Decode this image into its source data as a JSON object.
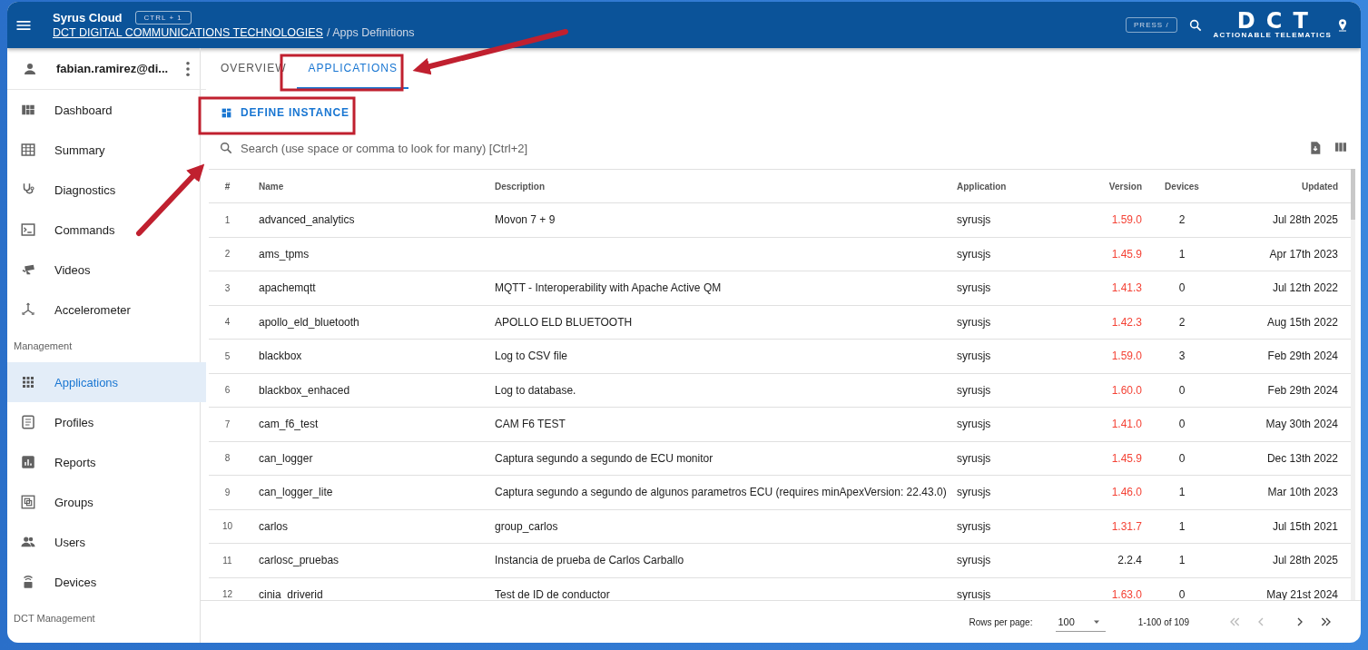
{
  "header": {
    "title": "Syrus Cloud",
    "shortcut": "CTRL + 1",
    "breadcrumb_link": "DCT DIGITAL COMMUNICATIONS TECHNOLOGIES",
    "breadcrumb_current": "/ Apps Definitions",
    "search_shortcut": "PRESS /",
    "logo_text": "DCT",
    "logo_tagline": "ACTIONABLE TELEMATICS"
  },
  "sidebar": {
    "user": "fabian.ramirez@di...",
    "nav": [
      {
        "kind": "link",
        "label": "Dashboard",
        "selected": false
      },
      {
        "kind": "link",
        "label": "Summary",
        "selected": false
      },
      {
        "kind": "link",
        "label": "Diagnostics",
        "selected": false
      },
      {
        "kind": "link",
        "label": "Commands",
        "selected": false
      },
      {
        "kind": "link",
        "label": "Videos",
        "selected": false
      },
      {
        "kind": "link",
        "label": "Accelerometer",
        "selected": false
      },
      {
        "kind": "heading",
        "label": "Management"
      },
      {
        "kind": "link",
        "label": "Applications",
        "selected": true
      },
      {
        "kind": "link",
        "label": "Profiles",
        "selected": false
      },
      {
        "kind": "link",
        "label": "Reports",
        "selected": false
      },
      {
        "kind": "link",
        "label": "Groups",
        "selected": false
      },
      {
        "kind": "link",
        "label": "Users",
        "selected": false
      },
      {
        "kind": "link",
        "label": "Devices",
        "selected": false
      },
      {
        "kind": "heading",
        "label": "DCT Management"
      }
    ]
  },
  "tabs": [
    {
      "label": "OVERVIEW",
      "selected": false
    },
    {
      "label": "APPLICATIONS",
      "selected": true
    }
  ],
  "define_button": "DEFINE INSTANCE",
  "search": {
    "placeholder": "Search (use space or comma to look for many) [Ctrl+2]"
  },
  "table": {
    "columns": [
      "#",
      "Name",
      "Description",
      "Application",
      "Version",
      "Devices",
      "Updated"
    ],
    "rows": [
      {
        "index": "1",
        "name": "advanced_analytics",
        "description": "Movon 7 + 9",
        "application": "syrusjs",
        "version": {
          "text": "1.59.0",
          "color": "#f44336"
        },
        "devices": "2",
        "updated": "Jul 28th 2025"
      },
      {
        "index": "2",
        "name": "ams_tpms",
        "description": "",
        "application": "syrusjs",
        "version": {
          "text": "1.45.9",
          "color": "#f44336"
        },
        "devices": "1",
        "updated": "Apr 17th 2023"
      },
      {
        "index": "3",
        "name": "apachemqtt",
        "description": "MQTT - Interoperability with Apache Active QM",
        "application": "syrusjs",
        "version": {
          "text": "1.41.3",
          "color": "#f44336"
        },
        "devices": "0",
        "updated": "Jul 12th 2022"
      },
      {
        "index": "4",
        "name": "apollo_eld_bluetooth",
        "description": "APOLLO ELD BLUETOOTH",
        "application": "syrusjs",
        "version": {
          "text": "1.42.3",
          "color": "#f44336"
        },
        "devices": "2",
        "updated": "Aug 15th 2022"
      },
      {
        "index": "5",
        "name": "blackbox",
        "description": "Log to CSV file",
        "application": "syrusjs",
        "version": {
          "text": "1.59.0",
          "color": "#f44336"
        },
        "devices": "3",
        "updated": "Feb 29th 2024"
      },
      {
        "index": "6",
        "name": "blackbox_enhaced",
        "description": "Log to database.",
        "application": "syrusjs",
        "version": {
          "text": "1.60.0",
          "color": "#f44336"
        },
        "devices": "0",
        "updated": "Feb 29th 2024"
      },
      {
        "index": "7",
        "name": "cam_f6_test",
        "description": "CAM F6 TEST",
        "application": "syrusjs",
        "version": {
          "text": "1.41.0",
          "color": "#f44336"
        },
        "devices": "0",
        "updated": "May 30th 2024"
      },
      {
        "index": "8",
        "name": "can_logger",
        "description": "Captura segundo a segundo de ECU monitor",
        "application": "syrusjs",
        "version": {
          "text": "1.45.9",
          "color": "#f44336"
        },
        "devices": "0",
        "updated": "Dec 13th 2022"
      },
      {
        "index": "9",
        "name": "can_logger_lite",
        "description": "Captura segundo a segundo de algunos parametros ECU (requires minApexVersion: 22.43.0)",
        "application": "syrusjs",
        "version": {
          "text": "1.46.0",
          "color": "#f44336"
        },
        "devices": "1",
        "updated": "Mar 10th 2023"
      },
      {
        "index": "10",
        "name": "carlos",
        "description": "group_carlos",
        "application": "syrusjs",
        "version": {
          "text": "1.31.7",
          "color": "#f44336"
        },
        "devices": "1",
        "updated": "Jul 15th 2021"
      },
      {
        "index": "11",
        "name": "carlosc_pruebas",
        "description": "Instancia de prueba de Carlos Carballo",
        "application": "syrusjs",
        "version": {
          "text": "2.2.4",
          "color": "#212121"
        },
        "devices": "1",
        "updated": "Jul 28th 2025"
      },
      {
        "index": "12",
        "name": "cinia_driverid",
        "description": "Test de ID de conductor",
        "application": "syrusjs",
        "version": {
          "text": "1.63.0",
          "color": "#f44336"
        },
        "devices": "0",
        "updated": "May 21st 2024"
      }
    ]
  },
  "pagination": {
    "rows_label": "Rows per page:",
    "rows_value": "100",
    "range": "1-100 of 109"
  }
}
